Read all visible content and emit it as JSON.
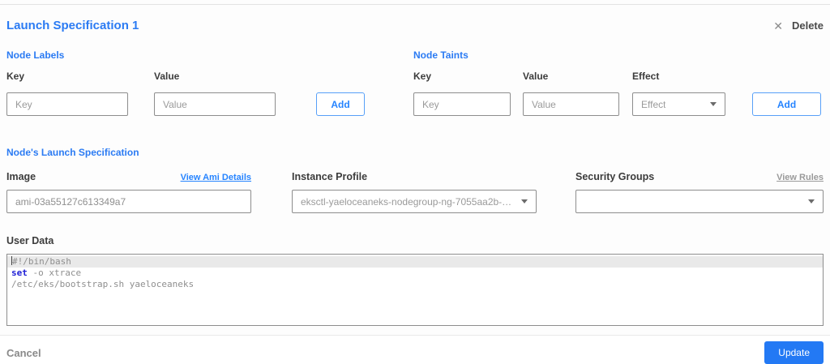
{
  "header": {
    "title": "Launch Specification 1",
    "delete_label": "Delete"
  },
  "node_labels": {
    "section_title": "Node Labels",
    "key_label": "Key",
    "key_placeholder": "Key",
    "value_label": "Value",
    "value_placeholder": "Value",
    "add_label": "Add"
  },
  "node_taints": {
    "section_title": "Node Taints",
    "key_label": "Key",
    "key_placeholder": "Key",
    "value_label": "Value",
    "value_placeholder": "Value",
    "effect_label": "Effect",
    "effect_placeholder": "Effect",
    "add_label": "Add"
  },
  "launch_spec": {
    "section_title": "Node's Launch Specification",
    "image_label": "Image",
    "view_ami_link": "View Ami Details",
    "image_value": "ami-03a55127c613349a7",
    "instance_profile_label": "Instance Profile",
    "instance_profile_value": "eksctl-yaeloceaneks-nodegroup-ng-7055aa2b-NodeInstanceProfile-...",
    "security_groups_label": "Security Groups",
    "security_groups_value": "",
    "view_rules_link": "View Rules"
  },
  "user_data": {
    "label": "User Data",
    "lines": [
      {
        "highlight": true,
        "cursor": true,
        "segments": [
          {
            "type": "plain",
            "text": "#!/bin/bash"
          }
        ]
      },
      {
        "highlight": false,
        "cursor": false,
        "segments": [
          {
            "type": "keyword",
            "text": "set"
          },
          {
            "type": "plain",
            "text": " -o xtrace"
          }
        ]
      },
      {
        "highlight": false,
        "cursor": false,
        "segments": [
          {
            "type": "plain",
            "text": "/etc/eks/bootstrap.sh yaeloceaneks"
          }
        ]
      }
    ]
  },
  "footer": {
    "cancel_label": "Cancel",
    "update_label": "Update"
  },
  "colors": {
    "section_blue": "#2b7bf3",
    "link_blue": "#2684ff",
    "button_blue": "#2379f4",
    "input_border_gray": "#8d8d8d",
    "keyword_blue": "#2121d6",
    "active_line_gray": "#e9e9e9"
  }
}
